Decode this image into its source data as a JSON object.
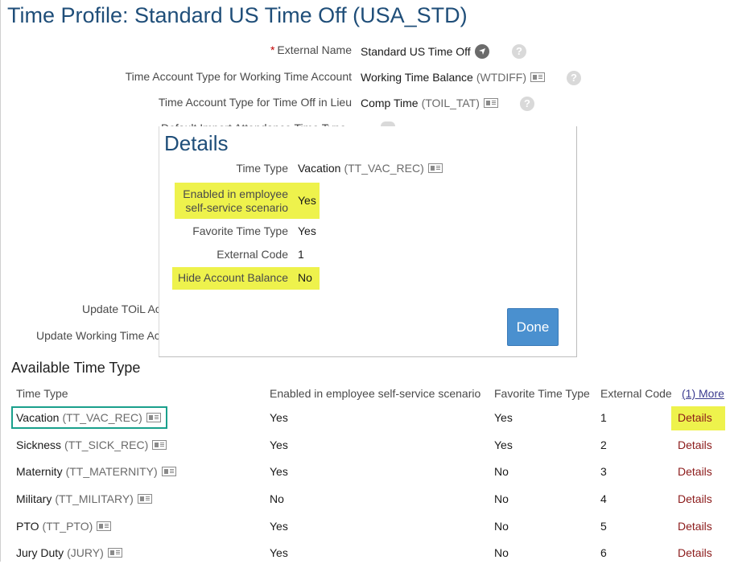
{
  "page": {
    "title": "Time Profile: Standard US Time Off (USA_STD)"
  },
  "form": {
    "external_name": {
      "label": "External Name",
      "required_mark": "*",
      "value": "Standard US Time Off"
    },
    "working_time_account": {
      "label": "Time Account Type for Working Time Account",
      "value": "Working Time Balance",
      "code": "(WTDIFF)"
    },
    "time_off_in_lieu": {
      "label": "Time Account Type for Time Off in Lieu",
      "value": "Comp Time",
      "code": "(TOIL_TAT)"
    },
    "obscured_default": "Default Import Attendance Time Type",
    "update_toil": "Update TOiL Ac",
    "update_working_time": "Update Working Time Ac"
  },
  "dialog": {
    "title": "Details",
    "time_type": {
      "label": "Time Type",
      "value": "Vacation",
      "code": "(TT_VAC_REC)"
    },
    "ess_enabled": {
      "label_line1": "Enabled in employee",
      "label_line2": "self-service scenario",
      "value": "Yes"
    },
    "favorite": {
      "label": "Favorite Time Type",
      "value": "Yes"
    },
    "external_code": {
      "label": "External Code",
      "value": "1"
    },
    "hide_balance": {
      "label": "Hide Account Balance",
      "value": "No"
    },
    "done_label": "Done"
  },
  "table": {
    "section_title": "Available Time Type",
    "headers": {
      "time_type": "Time Type",
      "ess": "Enabled in employee self-service scenario",
      "favorite": "Favorite Time Type",
      "external_code": "External Code",
      "more": "(1) More"
    },
    "rows": [
      {
        "name": "Vacation",
        "code": "(TT_VAC_REC)",
        "ess": "Yes",
        "favorite": "Yes",
        "ext": "1",
        "details": "Details"
      },
      {
        "name": "Sickness",
        "code": "(TT_SICK_REC)",
        "ess": "Yes",
        "favorite": "Yes",
        "ext": "2",
        "details": "Details"
      },
      {
        "name": "Maternity",
        "code": "(TT_MATERNITY)",
        "ess": "Yes",
        "favorite": "No",
        "ext": "3",
        "details": "Details"
      },
      {
        "name": "Military",
        "code": "(TT_MILITARY)",
        "ess": "No",
        "favorite": "No",
        "ext": "4",
        "details": "Details"
      },
      {
        "name": "PTO",
        "code": "(TT_PTO)",
        "ess": "Yes",
        "favorite": "No",
        "ext": "5",
        "details": "Details"
      },
      {
        "name": "Jury Duty",
        "code": "(JURY)",
        "ess": "Yes",
        "favorite": "No",
        "ext": "6",
        "details": "Details"
      }
    ]
  },
  "colors": {
    "title_blue": "#1f4e79",
    "highlight_yellow": "#eef24c",
    "done_button": "#4a90cf",
    "details_link": "#8b1a1a",
    "selection_outline": "#1aa08c"
  }
}
